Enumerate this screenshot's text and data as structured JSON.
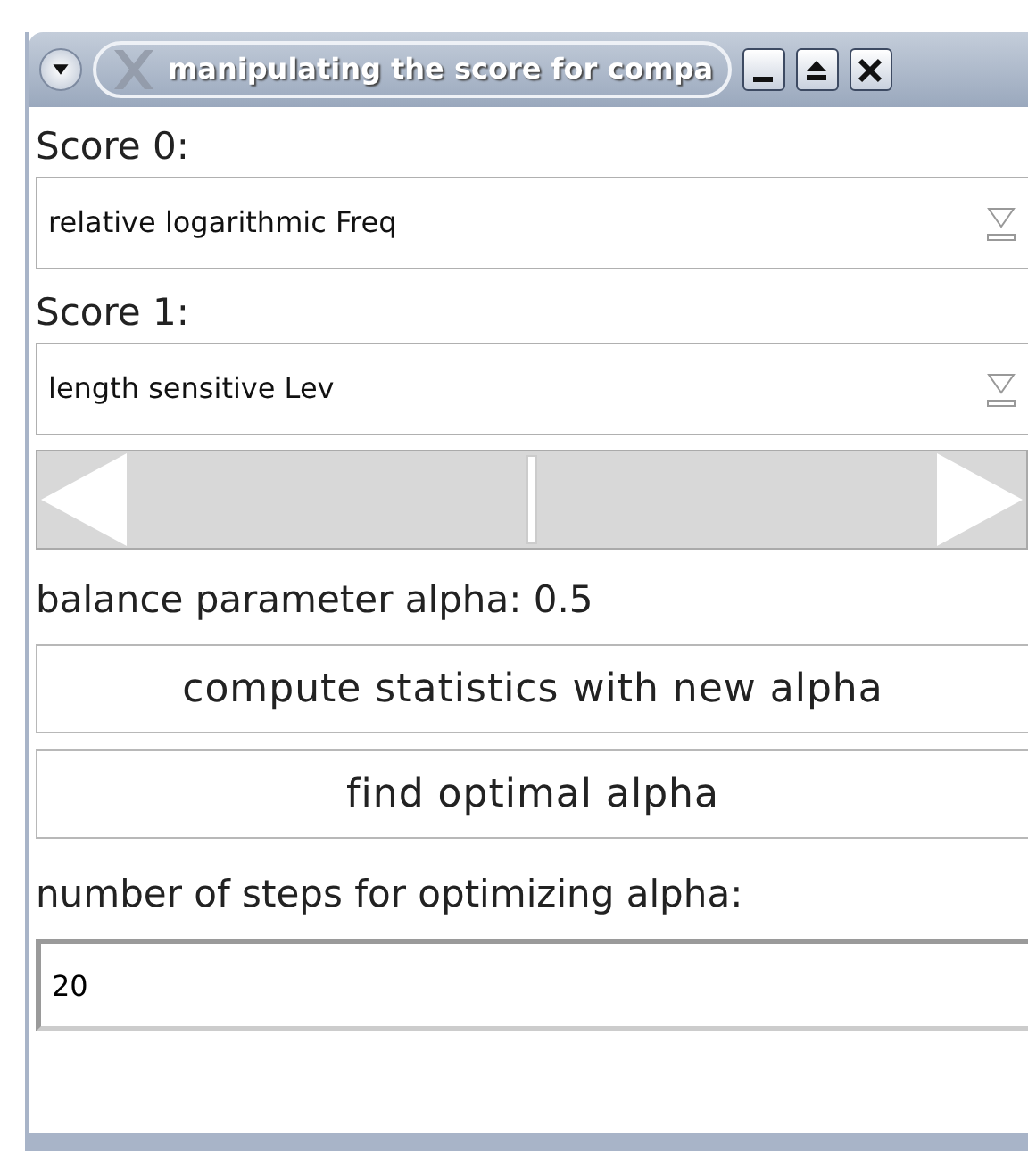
{
  "window": {
    "title": "manipulating the score for compa"
  },
  "score_0": {
    "label": "Score 0:",
    "value": "relative logarithmic Freq"
  },
  "score_1": {
    "label": "Score 1:",
    "value": "length sensitive Lev"
  },
  "alpha_slider": {
    "level": 0.5
  },
  "alpha_label": "balance parameter alpha: 0.5",
  "buttons": [
    "compute statistics with new alpha",
    "find optimal alpha"
  ],
  "steps": {
    "label": "number of steps for optimizing alpha:",
    "value": "20"
  }
}
